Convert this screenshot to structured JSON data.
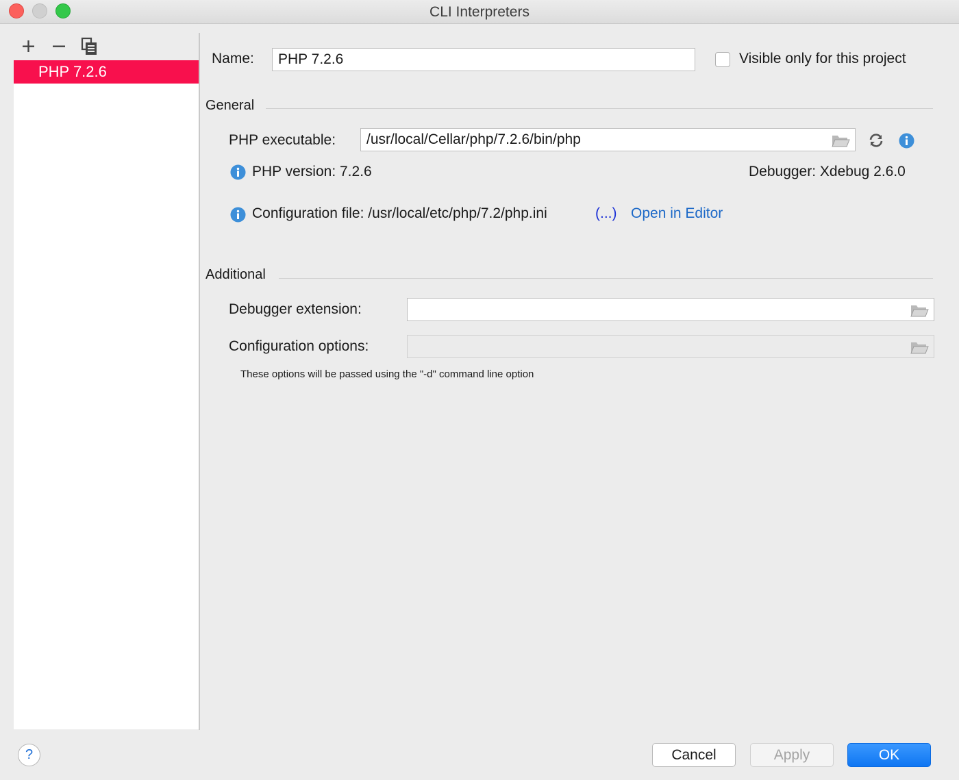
{
  "window": {
    "title": "CLI Interpreters"
  },
  "toolbar": {
    "add_icon": "plus-icon",
    "remove_icon": "minus-icon",
    "copy_icon": "copy-icon"
  },
  "interpreters": {
    "items": [
      {
        "label": "PHP 7.2.6",
        "selected": true
      }
    ]
  },
  "form": {
    "name_label": "Name:",
    "name_value": "PHP 7.2.6",
    "visible_label": "Visible only for this project",
    "visible_checked": false
  },
  "general": {
    "title": "General",
    "executable_label": "PHP executable:",
    "executable_value": "/usr/local/Cellar/php/7.2.6/bin/php",
    "php_version": "PHP version: 7.2.6",
    "debugger": "Debugger: Xdebug 2.6.0",
    "config_file": "Configuration file: /usr/local/etc/php/7.2/php.ini",
    "config_more": "(...)",
    "open_in_editor": "Open in Editor"
  },
  "additional": {
    "title": "Additional",
    "debugger_ext_label": "Debugger extension:",
    "debugger_ext_value": "",
    "config_options_label": "Configuration options:",
    "config_options_value": "",
    "hint": "These options will be passed using the \"-d\" command line option"
  },
  "buttons": {
    "help": "?",
    "cancel": "Cancel",
    "apply": "Apply",
    "ok": "OK"
  },
  "colors": {
    "selection": "#f8104d",
    "link": "#1b68c7",
    "link_more": "#1a2fd6",
    "ok_button": "#0f76f2",
    "info_icon": "#3d8fd9"
  }
}
